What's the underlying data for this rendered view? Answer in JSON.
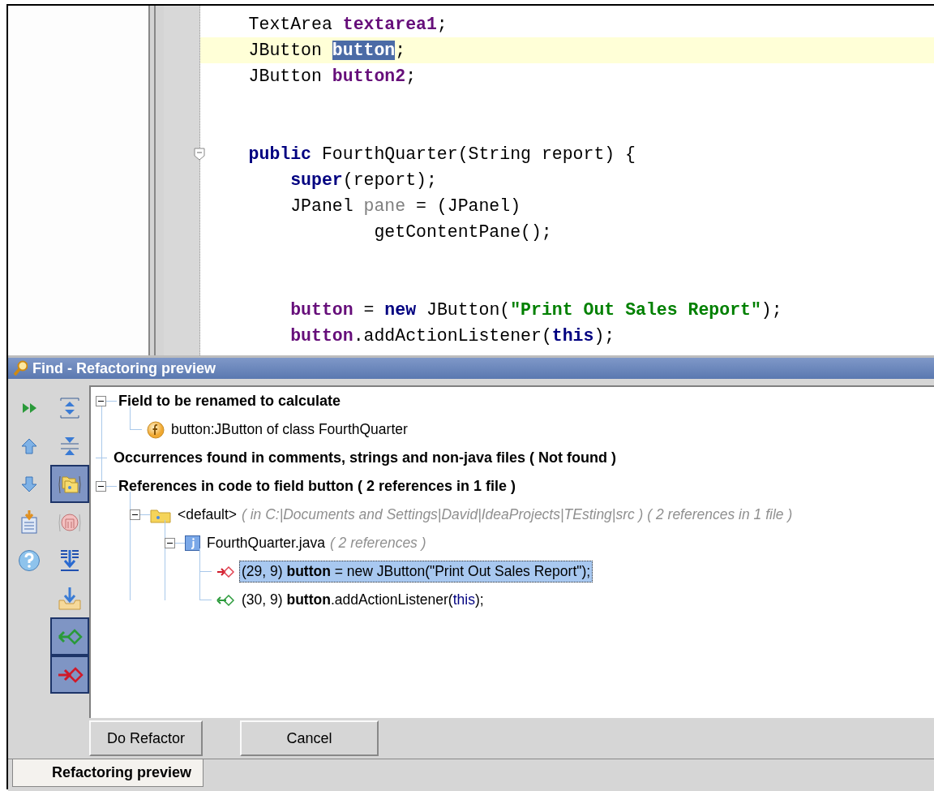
{
  "editor": {
    "lines": [
      {
        "current": false,
        "fold_marker": false,
        "tokens": [
          {
            "text": "    TextArea ",
            "kind": "plain"
          },
          {
            "text": "textarea1",
            "kind": "field"
          },
          {
            "text": ";",
            "kind": "plain"
          }
        ]
      },
      {
        "current": true,
        "fold_marker": false,
        "tokens": [
          {
            "text": "    JButton ",
            "kind": "plain"
          },
          {
            "text": "button",
            "kind": "selected"
          },
          {
            "text": ";",
            "kind": "plain"
          }
        ]
      },
      {
        "current": false,
        "fold_marker": false,
        "tokens": [
          {
            "text": "    JButton ",
            "kind": "plain"
          },
          {
            "text": "button2",
            "kind": "field"
          },
          {
            "text": ";",
            "kind": "plain"
          }
        ]
      },
      {
        "current": false,
        "fold_marker": false
      },
      {
        "current": false,
        "fold_marker": false
      },
      {
        "current": false,
        "fold_marker": true,
        "tokens": [
          {
            "text": "    public",
            "kind": "keyword"
          },
          {
            "text": " FourthQuarter(String report) {",
            "kind": "plain"
          }
        ]
      },
      {
        "current": false,
        "fold_marker": false,
        "tokens": [
          {
            "text": "        super",
            "kind": "keyword"
          },
          {
            "text": "(report);",
            "kind": "plain"
          }
        ]
      },
      {
        "current": false,
        "fold_marker": false,
        "tokens": [
          {
            "text": "        JPanel ",
            "kind": "plain"
          },
          {
            "text": "pane",
            "kind": "unused"
          },
          {
            "text": " = (JPanel)",
            "kind": "plain"
          }
        ]
      },
      {
        "current": false,
        "fold_marker": false,
        "tokens": [
          {
            "text": "                getContentPane();",
            "kind": "plain"
          }
        ]
      },
      {
        "current": false,
        "fold_marker": false
      },
      {
        "current": false,
        "fold_marker": false
      },
      {
        "current": false,
        "fold_marker": false,
        "tokens": [
          {
            "text": "        button",
            "kind": "field"
          },
          {
            "text": " = ",
            "kind": "plain"
          },
          {
            "text": "new",
            "kind": "keyword"
          },
          {
            "text": " JButton(",
            "kind": "plain"
          },
          {
            "text": "\"Print Out Sales Report\"",
            "kind": "string"
          },
          {
            "text": ");",
            "kind": "plain"
          }
        ]
      },
      {
        "current": false,
        "fold_marker": false,
        "tokens": [
          {
            "text": "        button",
            "kind": "field"
          },
          {
            "text": ".addActionListener(",
            "kind": "plain"
          },
          {
            "text": "this",
            "kind": "keyword"
          },
          {
            "text": ");",
            "kind": "plain"
          }
        ]
      }
    ]
  },
  "find_panel": {
    "title": "Find - Refactoring preview",
    "toolbar_toggles": [
      {
        "toggled": false
      },
      {
        "toggled": false
      },
      {
        "toggled": true
      },
      {
        "toggled": false
      },
      {
        "toggled": false
      },
      {
        "toggled": false
      },
      {
        "toggled": true
      },
      {
        "toggled": true
      }
    ],
    "tree": [
      {
        "kind": "group",
        "label": "Field to be renamed to calculate",
        "expanded": true,
        "children": [
          {
            "kind": "field",
            "label": "button:JButton of class FourthQuarter"
          }
        ]
      },
      {
        "kind": "group",
        "label": "Occurrences found in comments, strings and non-java files ( Not found )"
      },
      {
        "kind": "group",
        "label": "References in code to field button ( 2 references in 1 file )",
        "expanded": true,
        "children": [
          {
            "kind": "folder",
            "label": "<default>",
            "note": "( in C:|Documents and Settings|David|IdeaProjects|TEsting|src ) ( 2 references in 1 file )",
            "expanded": true,
            "children": [
              {
                "kind": "file",
                "label": "FourthQuarter.java",
                "note": "( 2 references )",
                "expanded": true,
                "children": [
                  {
                    "kind": "write",
                    "selected": true,
                    "parts": [
                      {
                        "text": "(29, 9) ",
                        "kind": "plain"
                      },
                      {
                        "text": "button",
                        "kind": "bold"
                      },
                      {
                        "text": " = new JButton(\"Print Out Sales Report\");",
                        "kind": "plain"
                      }
                    ]
                  },
                  {
                    "kind": "read",
                    "selected": false,
                    "parts": [
                      {
                        "text": "(30, 9) ",
                        "kind": "plain"
                      },
                      {
                        "text": "button",
                        "kind": "bold"
                      },
                      {
                        "text": ".addActionListener(",
                        "kind": "plain"
                      },
                      {
                        "text": "this",
                        "kind": "keyword"
                      },
                      {
                        "text": ");",
                        "kind": "plain"
                      }
                    ]
                  }
                ]
              }
            ]
          }
        ]
      }
    ],
    "buttons": [
      "Do Refactor",
      "Cancel"
    ]
  },
  "bottom_tabs": [
    {
      "label": "Refactoring preview",
      "selected": true
    }
  ]
}
